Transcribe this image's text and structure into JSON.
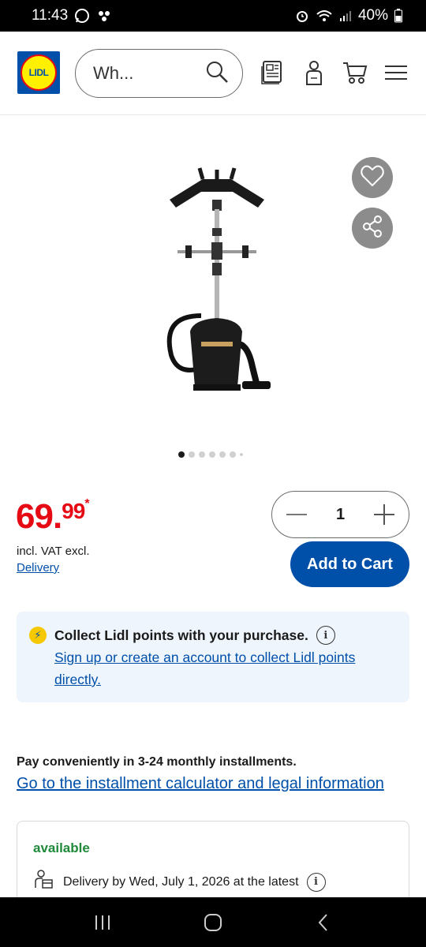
{
  "status_bar": {
    "time": "11:43",
    "battery": "40%",
    "icons": [
      "whatsapp-icon",
      "app-icon",
      "alarm-icon",
      "wifi-icon",
      "signal-icon",
      "battery-icon"
    ]
  },
  "header": {
    "logo_text": "LIDL",
    "search_placeholder": "Wh...",
    "icons": [
      "search-icon",
      "leaflet-icon",
      "account-icon",
      "cart-icon",
      "menu-icon"
    ]
  },
  "product": {
    "image_dots_count": 7,
    "active_dot": 0,
    "price_main": "69.",
    "price_cents": "99",
    "price_asterisk": "*",
    "vat_text": "incl. VAT excl.",
    "delivery_link": "Delivery",
    "quantity": "1",
    "add_to_cart": "Add to Cart"
  },
  "points": {
    "title": "Collect Lidl points with your purchase.",
    "link": "Sign up or create an account to collect Lidl points directly."
  },
  "installments": {
    "text": "Pay conveniently in 3-24 monthly installments.",
    "link": "Go to the installment calculator and legal information"
  },
  "availability": {
    "status": "available",
    "delivery": "Delivery by Wed, July 1, 2026 at the latest"
  },
  "colors": {
    "brand_blue": "#0050aa",
    "price_red": "#e60a14",
    "available_green": "#1f8a3a"
  }
}
